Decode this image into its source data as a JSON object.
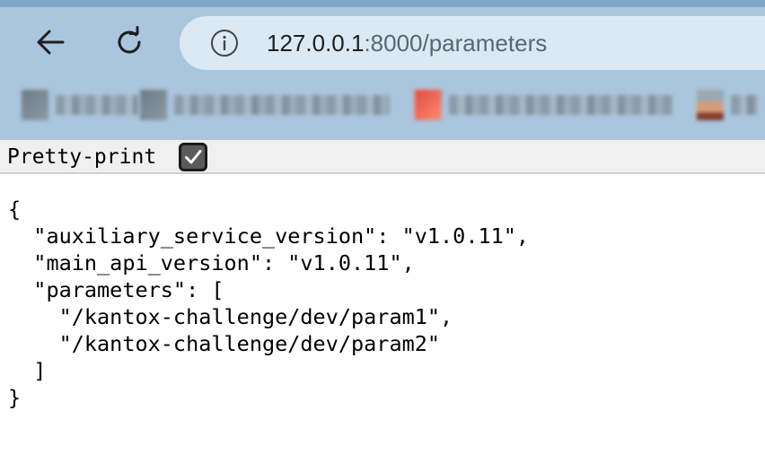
{
  "browser": {
    "url_host": "127.0.0.1",
    "url_path": ":8000/parameters",
    "icons": {
      "back": "back-arrow-icon",
      "reload": "reload-icon",
      "site_info": "info-icon"
    },
    "bookmarks": [
      "blurred-bookmark",
      "blurred-bookmark",
      "blurred-bookmark",
      "blurred-bookmark"
    ]
  },
  "page": {
    "pretty_print_label": "Pretty-print",
    "pretty_print_checked": true,
    "json_lines": [
      "{",
      "  \"auxiliary_service_version\": \"v1.0.11\",",
      "  \"main_api_version\": \"v1.0.11\",",
      "  \"parameters\": [",
      "    \"/kantox-challenge/dev/param1\",",
      "    \"/kantox-challenge/dev/param2\"",
      "  ]",
      "}"
    ]
  }
}
